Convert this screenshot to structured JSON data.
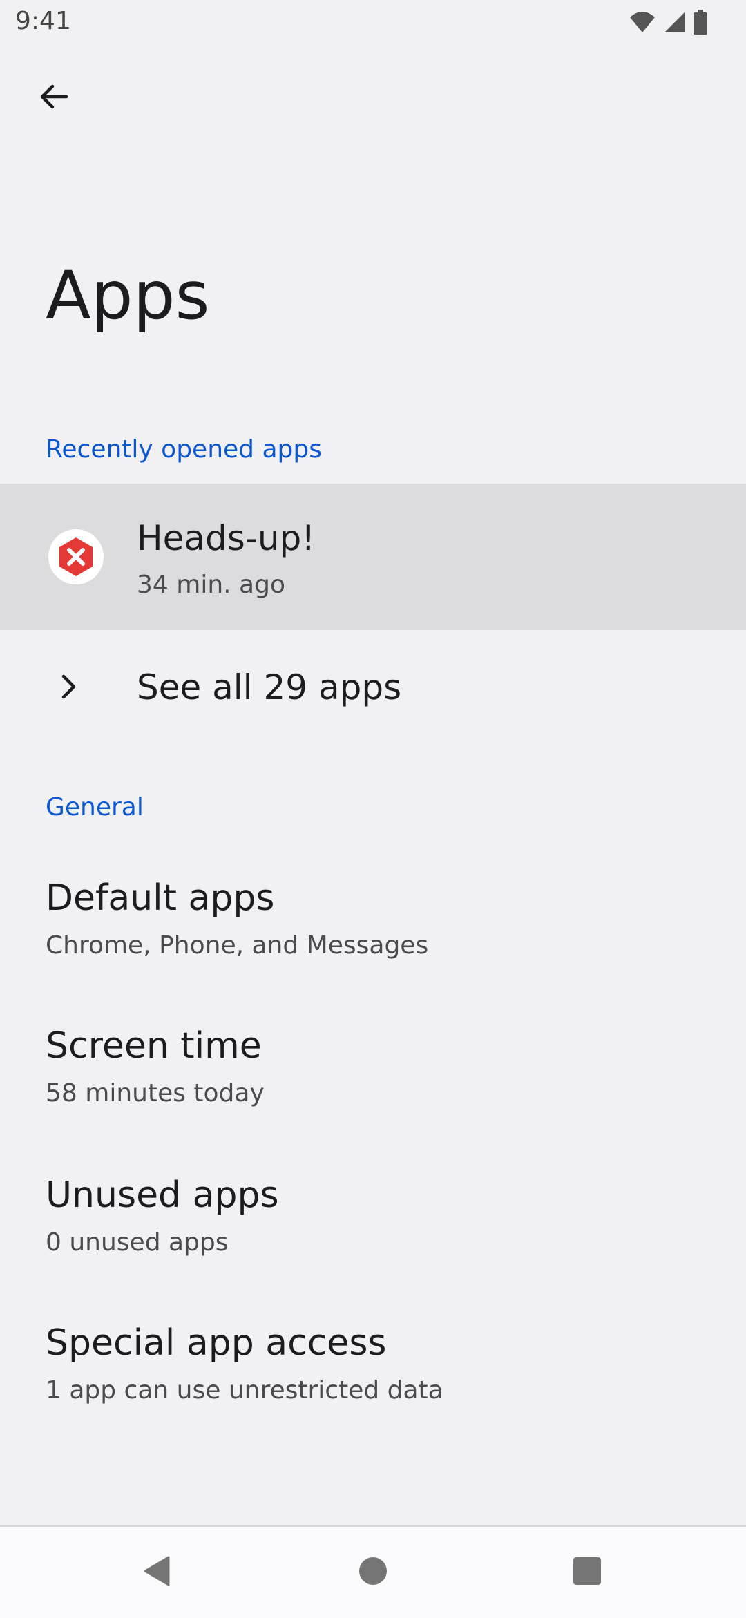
{
  "status_bar": {
    "time": "9:41"
  },
  "header": {
    "title": "Apps"
  },
  "recent": {
    "section_label": "Recently opened apps",
    "app": {
      "name": "Heads-up!",
      "last_opened": "34 min. ago",
      "icon_color": "#e53935"
    },
    "see_all_label": "See all 29 apps"
  },
  "general": {
    "section_label": "General",
    "items": [
      {
        "title": "Default apps",
        "summary": "Chrome, Phone, and Messages"
      },
      {
        "title": "Screen time",
        "summary": "58 minutes today"
      },
      {
        "title": "Unused apps",
        "summary": "0 unused apps"
      },
      {
        "title": "Special app access",
        "summary": "1 app can use unrestricted data"
      }
    ]
  },
  "colors": {
    "accent": "#0b57d0",
    "background": "#f1f1f4",
    "highlight": "#dcdcde"
  },
  "icons": {
    "back": "arrow-left-icon",
    "chevron": "chevron-right-icon",
    "wifi": "wifi-icon",
    "signal": "cell-signal-icon",
    "battery": "battery-icon",
    "nav_back": "nav-back-triangle-icon",
    "nav_home": "nav-home-circle-icon",
    "nav_recents": "nav-recents-square-icon"
  }
}
